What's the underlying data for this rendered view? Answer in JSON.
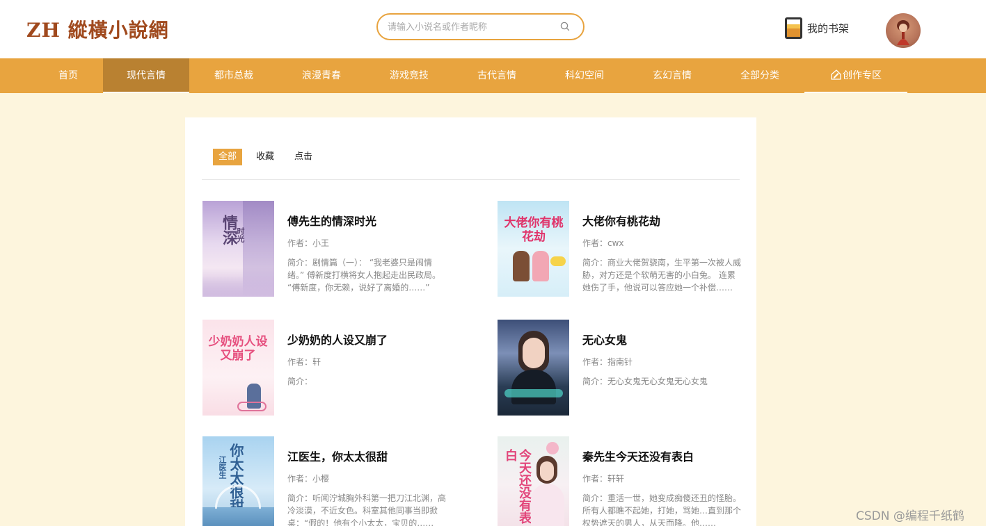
{
  "header": {
    "logo": "ZH 縱橫小說網",
    "search_placeholder": "请输入小说名或作者昵称",
    "search_icon": "search-icon",
    "shelf_label": "我的书架",
    "shelf_icon": "bookshelf-icon",
    "avatar": "user-avatar"
  },
  "nav": {
    "items": [
      {
        "label": "首页"
      },
      {
        "label": "现代言情",
        "active": true
      },
      {
        "label": "都市总裁"
      },
      {
        "label": "浪漫青春"
      },
      {
        "label": "游戏竞技"
      },
      {
        "label": "古代言情"
      },
      {
        "label": "科幻空间"
      },
      {
        "label": "玄幻言情"
      },
      {
        "label": "全部分类"
      },
      {
        "label": "创作专区",
        "icon": "pen-icon"
      }
    ]
  },
  "filters": [
    {
      "label": "全部",
      "active": true
    },
    {
      "label": "收藏"
    },
    {
      "label": "点击"
    }
  ],
  "books": [
    {
      "title": "傅先生的情深时光",
      "author": "作者：小王",
      "intro": "简介：剧情篇（一）：  “我老婆只是闹情绪。” 傅新度打横将女人抱起走出民政局。  “傅新度，你无赖，说好了离婚的……”"
    },
    {
      "title": "大佬你有桃花劫",
      "author": "作者：cwx",
      "intro": "简介：商业大佬贺骁南，生平第一次被人威胁，对方还是个软萌无害的小白兔。 连累她伤了手，他说可以答应她一个补偿……"
    },
    {
      "title": "少奶奶的人设又崩了",
      "author": "作者：轩",
      "intro": "简介："
    },
    {
      "title": "无心女鬼",
      "author": "作者：指南针",
      "intro": "简介：无心女鬼无心女鬼无心女鬼"
    },
    {
      "title": "江医生，你太太很甜",
      "author": "作者：小樱",
      "intro": "简介：听闻泞城胸外科第一把刀江北渊，高冷淡漠，不近女色。科室其他同事当即掀桌：“假的！他有个小太太，宝贝的……"
    },
    {
      "title": "秦先生今天还没有表白",
      "author": "作者：轩轩",
      "intro": "简介：重活一世，她变成痴傻还丑的怪胎。所有人都瞧不起她，打她，骂她…直到那个权势遮天的男人，从天而降。他……"
    }
  ],
  "covers": {
    "c1": "情深",
    "c1b": "时光",
    "c2": "大佬你有桃花劫",
    "c3": "少奶奶人设又崩了",
    "c5": "你太太很甜",
    "c5b": "江医生",
    "c6": "今天还没有表白"
  },
  "watermark": "CSDN @编程千纸鹤",
  "colors": {
    "accent": "#e8a43f",
    "nav_active": "#b98131",
    "page_bg": "#fdf5dd",
    "logo": "#a0491d"
  }
}
